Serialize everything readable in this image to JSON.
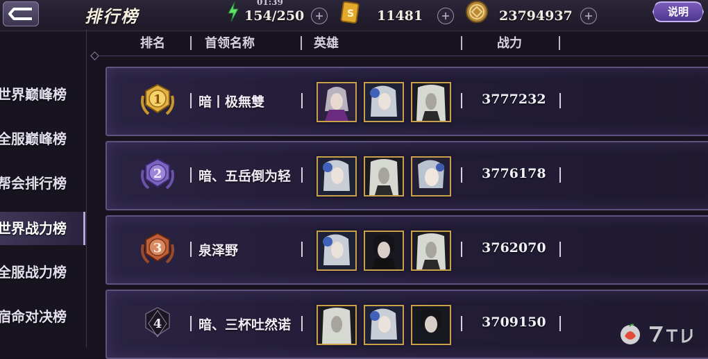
{
  "header": {
    "title": "排行榜",
    "timer": "01:39",
    "stamina": "154/250",
    "gold": "11481",
    "coins": "23794937",
    "help_label": "说明"
  },
  "columns": [
    "排名",
    "首领名称",
    "英雄",
    "战力"
  ],
  "sidebar": {
    "items": [
      {
        "label": "世界巅峰榜",
        "active": false
      },
      {
        "label": "全服巅峰榜",
        "active": false
      },
      {
        "label": "帮会排行榜",
        "active": false
      },
      {
        "label": "世界战力榜",
        "active": true
      },
      {
        "label": "全服战力榜",
        "active": false
      },
      {
        "label": "宿命对决榜",
        "active": false
      }
    ]
  },
  "rows": [
    {
      "rank": "1",
      "name": "暗丨极無雙",
      "power": "3777232",
      "badge": "gold"
    },
    {
      "rank": "2",
      "name": "暗、五岳倒为轻",
      "power": "3776178",
      "badge": "purple"
    },
    {
      "rank": "3",
      "name": "泉泽野",
      "power": "3762070",
      "badge": "bronze"
    },
    {
      "rank": "4",
      "name": "暗、三杯吐然诺",
      "power": "3709150",
      "badge": "dark"
    }
  ],
  "colors": {
    "accent": "#7a5cb8",
    "gold_badge": "#e0b040",
    "purple_badge": "#7c63c0",
    "bronze_badge": "#c0603a",
    "hero_frame": "#c9a14a"
  },
  "icons": {
    "back": "back-arrow-icon",
    "stamina": "lightning-icon",
    "gold": "gold-ticket-icon",
    "coins": "coin-icon",
    "plus": "plus-icon"
  }
}
